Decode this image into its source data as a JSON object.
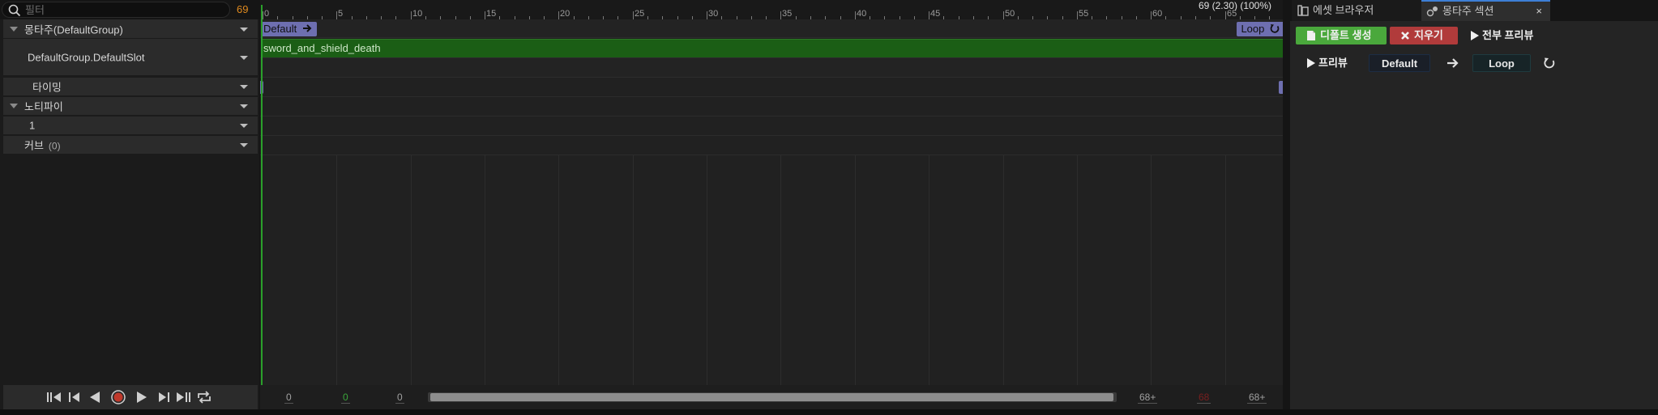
{
  "filter": {
    "placeholder": "필터",
    "frame_count": "69"
  },
  "tracks": {
    "montage_group": "몽타주(DefaultGroup)",
    "slot": "DefaultGroup.DefaultSlot",
    "timing": "타이밍",
    "notify": "노티파이",
    "notify_track": "1",
    "curve": "커브",
    "curve_count": "(0)"
  },
  "timeline": {
    "playhead_readout": "69 (2.30) (100%)",
    "ruler_labels": [
      "0",
      "5",
      "10",
      "15",
      "20",
      "25",
      "30",
      "35",
      "40",
      "45",
      "50",
      "55",
      "60",
      "65"
    ],
    "section_default": "Default",
    "section_loop": "Loop",
    "animation_segment": "sword_and_shield_death"
  },
  "timeline_bottom": {
    "view_start": "0",
    "play_start": "0",
    "clip_start": "0",
    "view_end": "68+",
    "play_end": "68",
    "clip_end": "68+"
  },
  "right_panel": {
    "tabs": [
      {
        "label": "에셋 브라우저",
        "icon": "asset-browser-icon"
      },
      {
        "label": "몽타주 섹션",
        "icon": "montage-sections-icon"
      }
    ],
    "close_label": "×",
    "create_default_label": "디폴트 생성",
    "clear_label": "지우기",
    "preview_all_label": "전부 프리뷰",
    "preview_label": "프리뷰",
    "section_default": "Default",
    "section_loop": "Loop"
  },
  "colors": {
    "accent_green": "#4aa83c",
    "danger_red": "#b13b3b",
    "section_purple": "#6e6fb0",
    "segment_green": "#1b5e15",
    "frame_count_orange": "#e08a1e",
    "playhead_red": "#c85a5a"
  }
}
